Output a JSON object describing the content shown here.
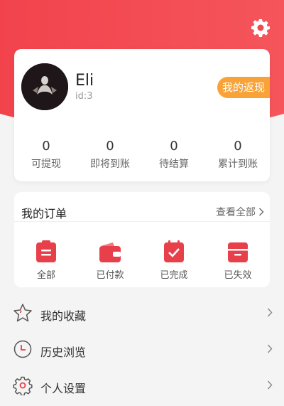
{
  "user": {
    "name": "Eli",
    "id_text": "id:3"
  },
  "rebate_button": "我的返现",
  "stats": [
    {
      "value": "0",
      "label": "可提现"
    },
    {
      "value": "0",
      "label": "即将到账"
    },
    {
      "value": "0",
      "label": "待结算"
    },
    {
      "value": "0",
      "label": "累计到账"
    }
  ],
  "orders": {
    "title": "我的订单",
    "view_all": "查看全部",
    "items": [
      {
        "label": "全部",
        "icon": "all-orders-icon"
      },
      {
        "label": "已付款",
        "icon": "wallet-icon"
      },
      {
        "label": "已完成",
        "icon": "check-icon"
      },
      {
        "label": "已失效",
        "icon": "expired-icon"
      }
    ]
  },
  "menu": [
    {
      "label": "我的收藏",
      "icon": "star-icon"
    },
    {
      "label": "历史浏览",
      "icon": "clock-icon"
    },
    {
      "label": "个人设置",
      "icon": "gear-icon"
    }
  ],
  "colors": {
    "header_red": "#f0434c",
    "accent_orange": "#f8a237",
    "icon_red": "#e8404a"
  }
}
